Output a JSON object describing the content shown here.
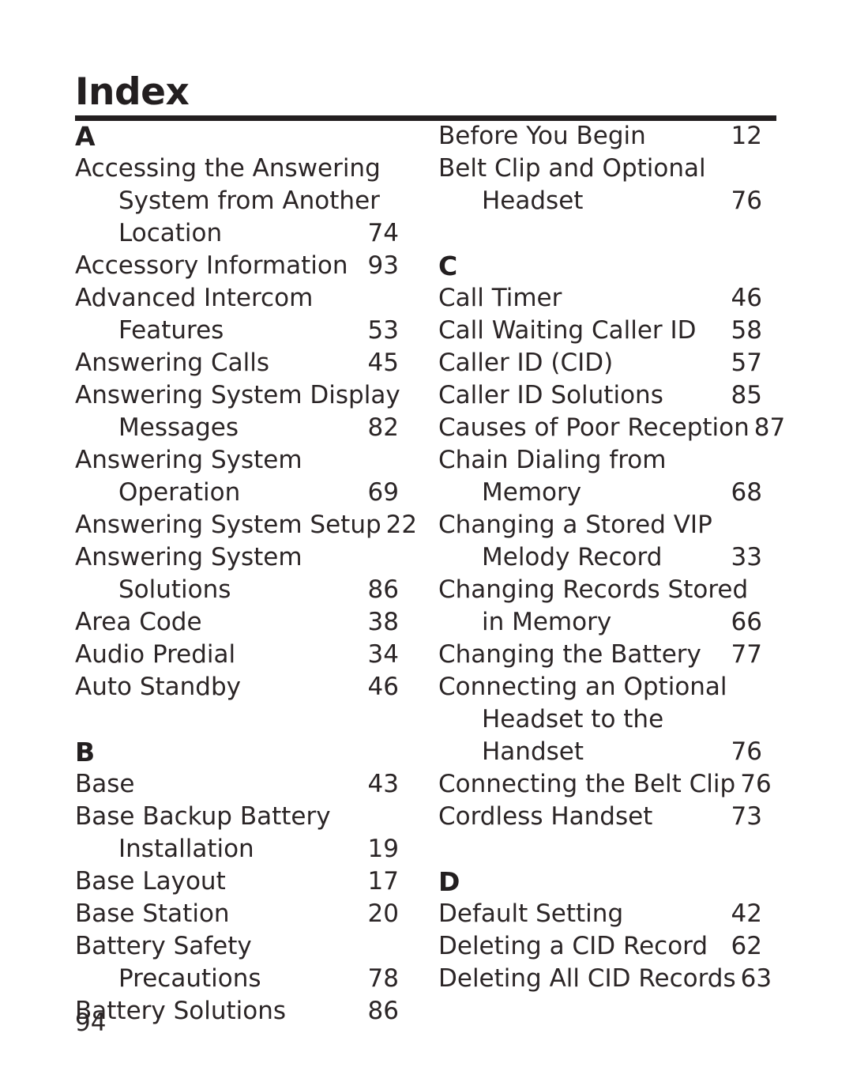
{
  "document": {
    "title": "Index",
    "folio": "94"
  },
  "columns": [
    {
      "id": "left",
      "sections": [
        {
          "letter": "A",
          "entries": [
            {
              "lines": [
                "Accessing the Answering",
                "System from Another",
                "Location"
              ],
              "page": "74"
            },
            {
              "lines": [
                "Accessory Information"
              ],
              "page": "93"
            },
            {
              "lines": [
                "Advanced Intercom",
                "Features"
              ],
              "page": "53"
            },
            {
              "lines": [
                "Answering Calls"
              ],
              "page": "45"
            },
            {
              "lines": [
                "Answering System Display",
                "Messages"
              ],
              "page": "82"
            },
            {
              "lines": [
                "Answering System",
                "Operation"
              ],
              "page": "69"
            },
            {
              "lines": [
                "Answering System Setup"
              ],
              "page": "22"
            },
            {
              "lines": [
                "Answering System",
                "Solutions"
              ],
              "page": "86"
            },
            {
              "lines": [
                "Area Code"
              ],
              "page": "38"
            },
            {
              "lines": [
                "Audio Predial"
              ],
              "page": "34"
            },
            {
              "lines": [
                "Auto Standby"
              ],
              "page": "46"
            }
          ]
        },
        {
          "letter": "B",
          "entries": [
            {
              "lines": [
                "Base"
              ],
              "page": "43"
            },
            {
              "lines": [
                "Base Backup Battery",
                "Installation"
              ],
              "page": "19"
            },
            {
              "lines": [
                "Base Layout"
              ],
              "page": "17"
            },
            {
              "lines": [
                "Base Station"
              ],
              "page": "20"
            },
            {
              "lines": [
                "Battery Safety",
                "Precautions"
              ],
              "page": "78"
            },
            {
              "lines": [
                "Battery Solutions"
              ],
              "page": "86"
            }
          ]
        }
      ]
    },
    {
      "id": "right",
      "sections": [
        {
          "letter": "",
          "entries": [
            {
              "lines": [
                "Before You Begin"
              ],
              "page": "12"
            },
            {
              "lines": [
                "Belt Clip and Optional",
                "Headset"
              ],
              "page": "76"
            }
          ]
        },
        {
          "letter": "C",
          "entries": [
            {
              "lines": [
                "Call Timer"
              ],
              "page": "46"
            },
            {
              "lines": [
                "Call Waiting Caller ID"
              ],
              "page": "58"
            },
            {
              "lines": [
                "Caller ID (CID)"
              ],
              "page": "57"
            },
            {
              "lines": [
                "Caller ID Solutions"
              ],
              "page": "85"
            },
            {
              "lines": [
                "Causes of Poor Reception"
              ],
              "page": "87"
            },
            {
              "lines": [
                "Chain Dialing from",
                "Memory"
              ],
              "page": "68"
            },
            {
              "lines": [
                "Changing a Stored VIP",
                "Melody Record"
              ],
              "page": "33"
            },
            {
              "lines": [
                "Changing Records Stored",
                "in Memory"
              ],
              "page": "66"
            },
            {
              "lines": [
                "Changing the Battery"
              ],
              "page": "77"
            },
            {
              "lines": [
                "Connecting an Optional",
                "Headset to the",
                "Handset"
              ],
              "page": "76"
            },
            {
              "lines": [
                "Connecting the Belt Clip"
              ],
              "page": "76"
            },
            {
              "lines": [
                "Cordless Handset"
              ],
              "page": "73"
            }
          ]
        },
        {
          "letter": "D",
          "entries": [
            {
              "lines": [
                "Default Setting"
              ],
              "page": "42"
            },
            {
              "lines": [
                "Deleting a CID Record"
              ],
              "page": "62"
            },
            {
              "lines": [
                "Deleting All CID Records"
              ],
              "page": "63"
            }
          ]
        }
      ]
    }
  ]
}
